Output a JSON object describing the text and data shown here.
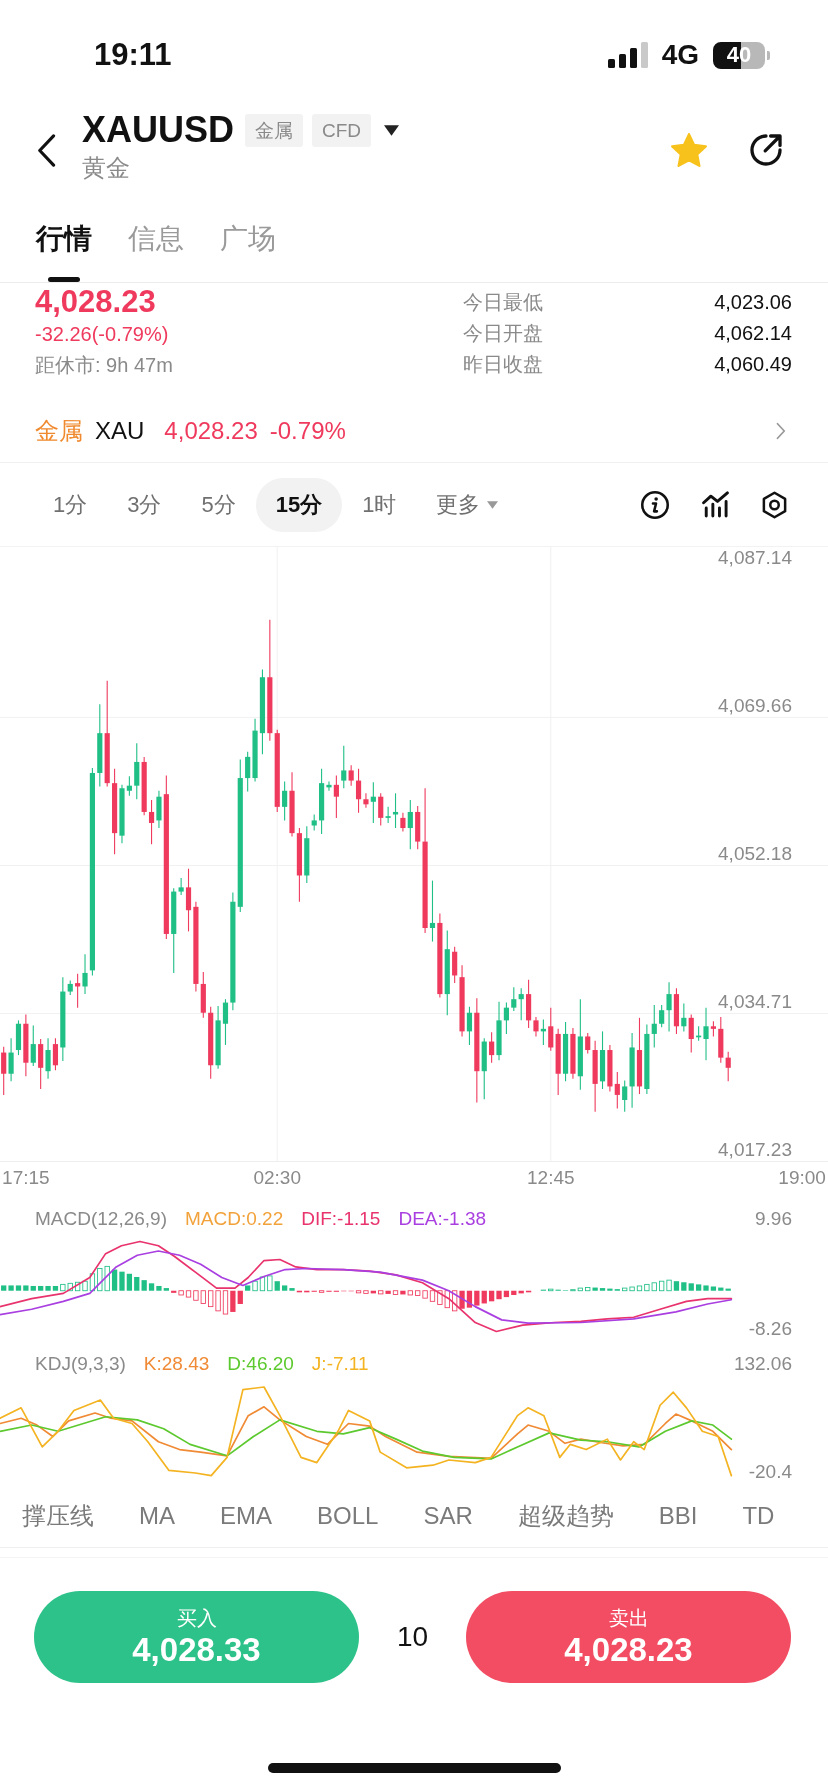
{
  "status_bar": {
    "time": "19:11",
    "network": "4G",
    "battery": "40"
  },
  "header": {
    "symbol": "XAUUSD",
    "tags": [
      "金属",
      "CFD"
    ],
    "name": "黄金",
    "favorite": true
  },
  "tabs": [
    {
      "label": "行情",
      "selected": true
    },
    {
      "label": "信息",
      "selected": false
    },
    {
      "label": "广场",
      "selected": false
    }
  ],
  "quote": {
    "price": "4,028.23",
    "change": "-32.26(-0.79%)",
    "session": "距休市: 9h 47m",
    "stats": [
      {
        "label": "今日最低",
        "value": "4,023.06"
      },
      {
        "label": "今日开盘",
        "value": "4,062.14"
      },
      {
        "label": "昨日收盘",
        "value": "4,060.49"
      }
    ]
  },
  "related": {
    "category": "金属",
    "symbol": "XAU",
    "price": "4,028.23",
    "change": "-0.79%"
  },
  "intervals": [
    {
      "label": "1分",
      "kind": "interval",
      "selected": false
    },
    {
      "label": "3分",
      "kind": "interval",
      "selected": false
    },
    {
      "label": "5分",
      "kind": "interval",
      "selected": false
    },
    {
      "label": "15分",
      "kind": "interval",
      "selected": true
    },
    {
      "label": "1时",
      "kind": "interval",
      "selected": false
    },
    {
      "label": "更多",
      "kind": "menu",
      "selected": false
    }
  ],
  "price_chart": {
    "chart_data": {
      "type": "candlestick",
      "grid": true,
      "categories": [
        null,
        null,
        null,
        "17:15",
        null,
        null,
        null,
        null,
        null,
        null,
        null,
        null,
        null,
        null,
        null,
        null,
        null,
        null,
        null,
        null,
        null,
        null,
        null,
        null,
        null,
        null,
        null,
        null,
        null,
        null,
        null,
        null,
        null,
        null,
        null,
        null,
        null,
        "02:30",
        null,
        null,
        null,
        null,
        null,
        null,
        null,
        null,
        null,
        null,
        null,
        null,
        null,
        null,
        null,
        null,
        null,
        null,
        null,
        null,
        null,
        null,
        null,
        null,
        null,
        null,
        null,
        null,
        null,
        null,
        null,
        null,
        null,
        null,
        null,
        null,
        "12:45",
        null,
        null,
        null,
        null,
        null,
        null,
        null,
        null,
        null,
        null,
        null,
        null,
        null,
        null,
        null,
        null,
        null,
        null,
        null,
        null,
        null,
        null,
        null,
        null,
        null,
        null,
        null,
        null,
        null,
        null,
        null,
        null,
        null,
        "19:00",
        null,
        null,
        null
      ],
      "ohlc": [
        [
          4030.1,
          4030.8,
          4025.1,
          4027.6
        ],
        [
          4027.6,
          4031.8,
          4026.7,
          4030.1
        ],
        [
          4030.4,
          4033.9,
          4029.8,
          4033.5
        ],
        [
          4033.5,
          4034.6,
          4027.3,
          4028.9
        ],
        [
          4028.9,
          4033.3,
          4028.5,
          4031.1
        ],
        [
          4031.1,
          4031.7,
          4025.8,
          4028.3
        ],
        [
          4027.9,
          4031.8,
          4027.0,
          4030.4
        ],
        [
          4031.1,
          4031.8,
          4028.0,
          4028.6
        ],
        [
          4030.7,
          4039.0,
          4029.1,
          4037.3
        ],
        [
          4037.3,
          4038.6,
          4036.9,
          4038.2
        ],
        [
          4038.3,
          4039.4,
          4035.4,
          4037.9
        ],
        [
          4037.9,
          4041.7,
          4037.0,
          4039.5
        ],
        [
          4039.8,
          4063.7,
          4039.2,
          4063.1
        ],
        [
          4063.1,
          4071.2,
          4061.5,
          4067.8
        ],
        [
          4067.8,
          4074.0,
          4061.5,
          4061.9
        ],
        [
          4061.9,
          4063.6,
          4053.5,
          4056.0
        ],
        [
          4055.7,
          4061.7,
          4054.8,
          4061.3
        ],
        [
          4061.0,
          4062.7,
          4060.4,
          4061.6
        ],
        [
          4061.6,
          4066.6,
          4060.0,
          4064.4
        ],
        [
          4064.4,
          4065.0,
          4058.1,
          4058.5
        ],
        [
          4058.5,
          4059.9,
          4054.7,
          4057.2
        ],
        [
          4057.5,
          4061.0,
          4056.6,
          4060.3
        ],
        [
          4060.6,
          4062.8,
          4043.5,
          4044.1
        ],
        [
          4044.1,
          4049.5,
          4039.5,
          4049.1
        ],
        [
          4049.1,
          4050.7,
          4048.7,
          4049.6
        ],
        [
          4049.6,
          4051.8,
          4044.4,
          4046.9
        ],
        [
          4047.3,
          4047.9,
          4037.3,
          4038.2
        ],
        [
          4038.2,
          4039.6,
          4034.2,
          4034.8
        ],
        [
          4034.8,
          4035.5,
          4027.0,
          4028.6
        ],
        [
          4028.6,
          4035.6,
          4028.2,
          4033.9
        ],
        [
          4033.5,
          4036.4,
          4031.0,
          4036.0
        ],
        [
          4036.0,
          4049.0,
          4035.1,
          4047.9
        ],
        [
          4047.3,
          4064.7,
          4046.7,
          4062.5
        ],
        [
          4062.5,
          4065.6,
          4060.9,
          4065.0
        ],
        [
          4062.5,
          4069.5,
          4062.1,
          4068.1
        ],
        [
          4067.8,
          4075.3,
          4065.3,
          4074.4
        ],
        [
          4074.4,
          4081.2,
          4066.9,
          4067.8
        ],
        [
          4067.8,
          4068.2,
          4058.5,
          4059.1
        ],
        [
          4059.1,
          4062.1,
          4057.5,
          4061.0
        ],
        [
          4061.0,
          4063.2,
          4055.6,
          4056.0
        ],
        [
          4056.0,
          4056.6,
          4047.9,
          4051.0
        ],
        [
          4051.0,
          4056.8,
          4050.1,
          4055.4
        ],
        [
          4056.9,
          4058.2,
          4056.3,
          4057.5
        ],
        [
          4057.5,
          4063.6,
          4055.9,
          4061.9
        ],
        [
          4061.4,
          4062.1,
          4061.0,
          4061.7
        ],
        [
          4061.7,
          4062.8,
          4057.8,
          4060.3
        ],
        [
          4062.2,
          4066.3,
          4061.3,
          4063.4
        ],
        [
          4063.4,
          4064.0,
          4061.6,
          4062.2
        ],
        [
          4062.2,
          4063.6,
          4058.4,
          4060.0
        ],
        [
          4060.0,
          4060.7,
          4059.0,
          4059.4
        ],
        [
          4059.7,
          4062.0,
          4057.2,
          4060.3
        ],
        [
          4060.3,
          4060.7,
          4056.9,
          4057.8
        ],
        [
          4057.8,
          4059.1,
          4057.2,
          4058.0
        ],
        [
          4058.2,
          4060.7,
          4056.6,
          4058.5
        ],
        [
          4057.8,
          4058.4,
          4056.2,
          4056.6
        ],
        [
          4056.6,
          4059.9,
          4054.1,
          4058.5
        ],
        [
          4058.5,
          4059.2,
          4054.1,
          4055.0
        ],
        [
          4055.0,
          4061.3,
          4044.2,
          4044.8
        ],
        [
          4044.8,
          4050.4,
          4043.2,
          4045.4
        ],
        [
          4045.4,
          4046.5,
          4036.6,
          4037.0
        ],
        [
          4037.0,
          4044.5,
          4034.5,
          4042.3
        ],
        [
          4042.0,
          4042.6,
          4038.3,
          4039.2
        ],
        [
          4039.0,
          4040.4,
          4032.0,
          4032.6
        ],
        [
          4032.6,
          4035.5,
          4031.0,
          4034.8
        ],
        [
          4034.8,
          4036.5,
          4024.2,
          4027.9
        ],
        [
          4027.9,
          4031.8,
          4024.6,
          4031.4
        ],
        [
          4031.4,
          4032.5,
          4028.9,
          4029.8
        ],
        [
          4029.8,
          4036.1,
          4029.2,
          4033.9
        ],
        [
          4033.9,
          4036.0,
          4032.3,
          4035.4
        ],
        [
          4035.4,
          4037.8,
          4035.0,
          4036.4
        ],
        [
          4036.4,
          4037.7,
          4033.9,
          4037.0
        ],
        [
          4037.0,
          4038.7,
          4033.0,
          4033.9
        ],
        [
          4033.9,
          4034.3,
          4032.0,
          4032.6
        ],
        [
          4032.6,
          4034.0,
          4031.0,
          4032.9
        ],
        [
          4033.2,
          4035.4,
          4030.3,
          4030.7
        ],
        [
          4032.3,
          4032.9,
          4025.1,
          4027.6
        ],
        [
          4027.6,
          4033.7,
          4026.7,
          4032.3
        ],
        [
          4032.3,
          4033.0,
          4027.0,
          4027.6
        ],
        [
          4027.3,
          4036.4,
          4025.7,
          4032.0
        ],
        [
          4032.0,
          4032.4,
          4030.0,
          4030.4
        ],
        [
          4030.4,
          4031.5,
          4023.1,
          4026.4
        ],
        [
          4026.7,
          4032.6,
          4025.8,
          4030.4
        ],
        [
          4030.4,
          4031.0,
          4025.5,
          4026.1
        ],
        [
          4026.4,
          4027.8,
          4023.5,
          4025.1
        ],
        [
          4024.5,
          4026.8,
          4023.1,
          4026.1
        ],
        [
          4026.1,
          4032.4,
          4023.6,
          4030.7
        ],
        [
          4030.4,
          4034.2,
          4025.2,
          4026.1
        ],
        [
          4025.8,
          4033.4,
          4025.2,
          4032.3
        ],
        [
          4032.3,
          4035.7,
          4030.7,
          4033.5
        ],
        [
          4033.5,
          4035.7,
          4033.1,
          4035.1
        ],
        [
          4035.1,
          4038.4,
          4032.6,
          4037.0
        ],
        [
          4037.0,
          4037.7,
          4032.3,
          4033.2
        ],
        [
          4033.2,
          4035.9,
          4032.6,
          4034.2
        ],
        [
          4034.2,
          4034.6,
          4030.1,
          4031.7
        ],
        [
          4031.9,
          4033.2,
          4031.5,
          4032.1
        ],
        [
          4031.7,
          4035.4,
          4029.2,
          4033.2
        ],
        [
          4033.2,
          4033.8,
          4032.0,
          4032.9
        ],
        [
          4032.9,
          4034.3,
          4028.9,
          4029.5
        ],
        [
          4029.5,
          4030.2,
          4026.7,
          4028.3
        ],
        null,
        null,
        null,
        null,
        null,
        null,
        null,
        null,
        null,
        null,
        null,
        null,
        null
      ],
      "ylim": [
        4017.23,
        4087.14
      ],
      "yticks": [
        {
          "value": 4087.14,
          "label": "4,087.14"
        },
        {
          "value": 4069.66,
          "label": "4,069.66"
        },
        {
          "value": 4052.18,
          "label": "4,052.18"
        },
        {
          "value": 4034.71,
          "label": "4,034.71"
        },
        {
          "value": 4017.23,
          "label": "4,017.23"
        }
      ]
    }
  },
  "macd": {
    "title": "MACD(12,26,9)",
    "legend": [
      {
        "text": "MACD:0.22",
        "color": "#f2a23a"
      },
      {
        "text": "DIF:-1.15",
        "color": "#e8336d"
      },
      {
        "text": "DEA:-1.38",
        "color": "#a93fe0"
      }
    ],
    "max": "9.96",
    "min": "-8.26"
  },
  "kdj": {
    "title": "KDJ(9,3,3)",
    "legend": [
      {
        "text": "K:28.43",
        "color": "#f08a34"
      },
      {
        "text": "D:46.20",
        "color": "#5cc92e"
      },
      {
        "text": "J:-7.11",
        "color": "#f4b321"
      }
    ],
    "max": "132.06",
    "min": "-20.4"
  },
  "indicators": [
    {
      "label": "撑压线",
      "selected": false
    },
    {
      "label": "MA",
      "selected": false
    },
    {
      "label": "EMA",
      "selected": false
    },
    {
      "label": "BOLL",
      "selected": false
    },
    {
      "label": "SAR",
      "selected": false
    },
    {
      "label": "超级趋势",
      "selected": false
    },
    {
      "label": "BBI",
      "selected": false
    },
    {
      "label": "TD",
      "selected": false
    }
  ],
  "trade": {
    "buy": {
      "label": "买入",
      "price": "4,028.33"
    },
    "quantity": "10",
    "sell": {
      "label": "卖出",
      "price": "4,028.23"
    }
  }
}
